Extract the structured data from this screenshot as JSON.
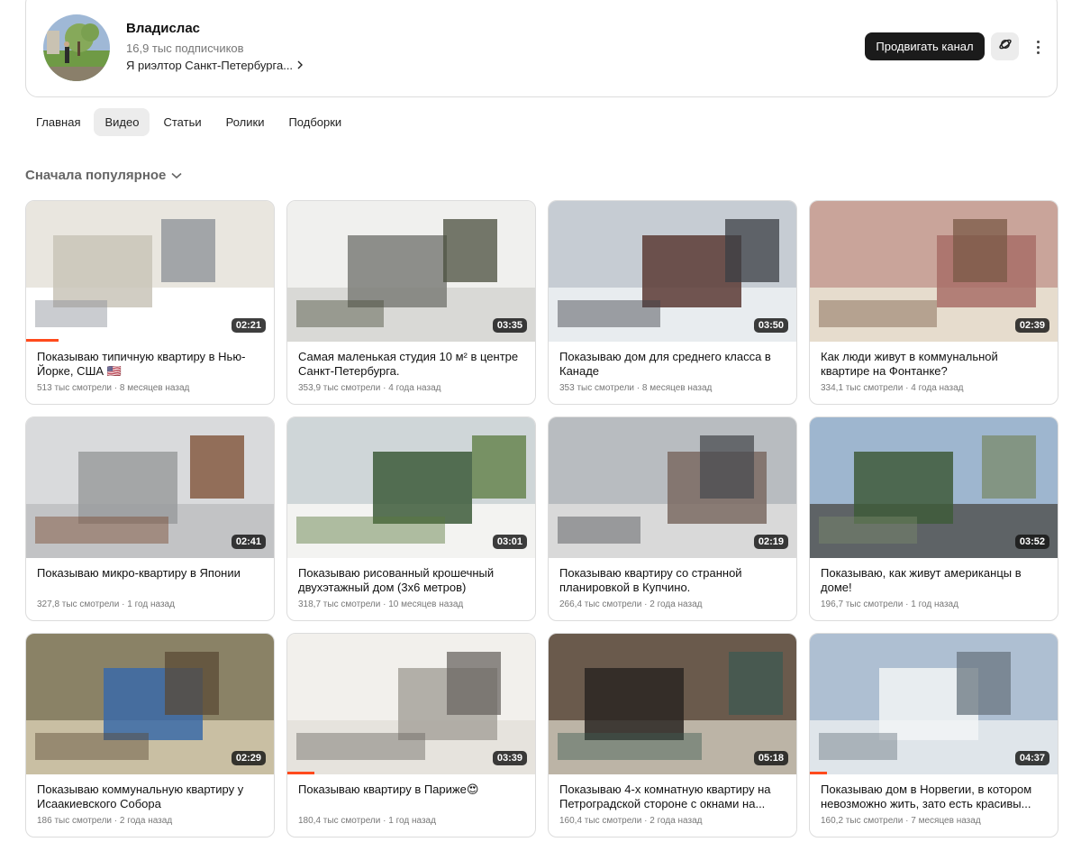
{
  "channel": {
    "name": "Владислас",
    "subscribers": "16,9 тыс подписчиков",
    "description": "Я риэлтор Санкт-Петербурга...",
    "promote_label": "Продвигать канал",
    "avatar_icon": "avatar-photo",
    "planet_icon": "planet-icon",
    "more_icon": "more-vertical-icon"
  },
  "tabs": [
    {
      "label": "Главная",
      "active": false
    },
    {
      "label": "Видео",
      "active": true
    },
    {
      "label": "Статьи",
      "active": false
    },
    {
      "label": "Ролики",
      "active": false
    },
    {
      "label": "Подборки",
      "active": false
    }
  ],
  "sort": {
    "label": "Сначала популярное"
  },
  "colors": {
    "accent": "#1b1b1b",
    "progress": "#ff4a1c",
    "border": "#dcdcdc"
  },
  "videos": [
    {
      "title": "Показываю типичную квартиру в Нью-Йорке, США 🇺🇸",
      "views": "513 тыс смотрели",
      "age": "8 месяцев назад",
      "duration": "02:21",
      "progress": 0.13,
      "palette": [
        "#e9e6df",
        "#c9c4b8",
        "#ffffff",
        "#8a8f96"
      ]
    },
    {
      "title": "Самая маленькая студия 10 м² в центре Санкт-Петербурга.",
      "views": "353,9 тыс смотрели",
      "age": "4 года назад",
      "duration": "03:35",
      "progress": 0,
      "palette": [
        "#f0f0ee",
        "#7b7d78",
        "#d9d9d6",
        "#4a4d3c"
      ]
    },
    {
      "title": "Показываю дом для среднего класса в Канаде",
      "views": "353 тыс смотрели",
      "age": "8 месяцев назад",
      "duration": "03:50",
      "progress": 0,
      "palette": [
        "#c6ccd3",
        "#5a3a34",
        "#e8ecef",
        "#3b3f44"
      ]
    },
    {
      "title": "Как люди живут в коммунальной квартире на Фонтанке?",
      "views": "334,1 тыс смотрели",
      "age": "4 года назад",
      "duration": "02:39",
      "progress": 0,
      "palette": [
        "#c9a49a",
        "#a86f67",
        "#e6dccd",
        "#7a5a46"
      ]
    },
    {
      "title": "Показываю микро-квартиру в Японии",
      "views": "327,8 тыс смотрели",
      "age": "1 год назад",
      "duration": "02:41",
      "progress": 0,
      "palette": [
        "#d9dadc",
        "#9a9c9e",
        "#c2c3c5",
        "#7a4a2e"
      ]
    },
    {
      "title": "Показываю рисованный крошечный двухэтажный дом (3х6 метров)",
      "views": "318,7 тыс смотрели",
      "age": "10 месяцев назад",
      "duration": "03:01",
      "progress": 0,
      "palette": [
        "#cfd6d8",
        "#3c5a3a",
        "#f3f3f1",
        "#5a7a3e"
      ]
    },
    {
      "title": "Показываю квартиру со странной планировкой в Купчино.",
      "views": "266,4 тыс смотрели",
      "age": "2 года назад",
      "duration": "02:19",
      "progress": 0,
      "palette": [
        "#b8bcc0",
        "#7a6a62",
        "#d9d9d9",
        "#4a4c50"
      ]
    },
    {
      "title": "Показываю, как живут американцы в доме!",
      "views": "196,7 тыс смотрели",
      "age": "1 год назад",
      "duration": "03:52",
      "progress": 0,
      "palette": [
        "#9eb6cf",
        "#3e5a3a",
        "#5e6366",
        "#7a8a6a"
      ]
    },
    {
      "title": "Показываю коммунальную квартиру у Исаакиевского Собора",
      "views": "186 тыс смотрели",
      "age": "2 года назад",
      "duration": "02:29",
      "progress": 0,
      "palette": [
        "#8a8266",
        "#3a6aa8",
        "#c9bfa3",
        "#5a4a36"
      ]
    },
    {
      "title": "Показываю квартиру в Париже😍",
      "views": "180,4 тыс смотрели",
      "age": "1 год назад",
      "duration": "03:39",
      "progress": 0.11,
      "palette": [
        "#f2f0ec",
        "#a7a39c",
        "#e6e3dd",
        "#6a6662"
      ]
    },
    {
      "title": "Показываю 4-х комнатную квартиру на Петроградской стороне с окнами на...",
      "views": "160,4 тыс смотрели",
      "age": "2 года назад",
      "duration": "05:18",
      "progress": 0,
      "palette": [
        "#6a5a4c",
        "#2a2622",
        "#bcb4a6",
        "#3e5a52"
      ]
    },
    {
      "title": "Показываю дом в Норвегии, в котором невозможно жить, зато есть красивы...",
      "views": "160,2 тыс смотрели",
      "age": "7 месяцев назад",
      "duration": "04:37",
      "progress": 0.07,
      "palette": [
        "#aebfd2",
        "#f2f4f6",
        "#dfe5ea",
        "#6a7580"
      ]
    }
  ]
}
